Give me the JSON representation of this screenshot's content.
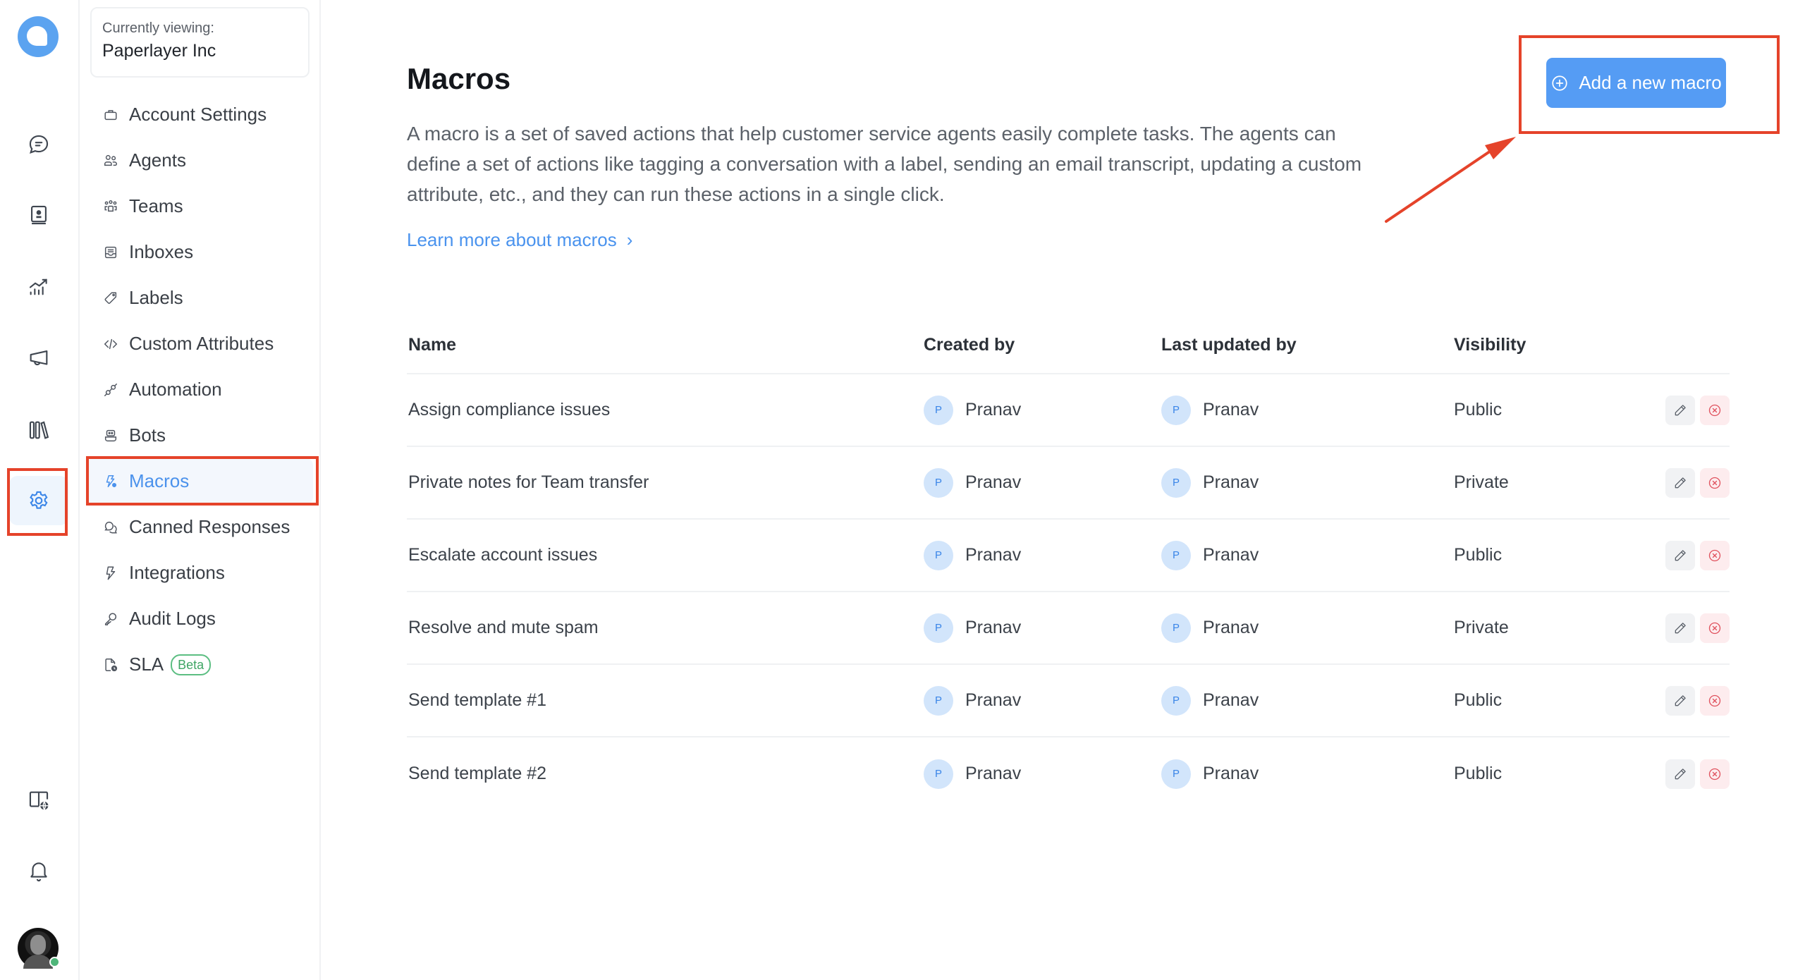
{
  "rail": {
    "items": [
      {
        "icon": "chat-bubble-icon",
        "label": "Conversations"
      },
      {
        "icon": "contact-book-icon",
        "label": "Contacts"
      },
      {
        "icon": "reports-chart-icon",
        "label": "Reports"
      },
      {
        "icon": "megaphone-icon",
        "label": "Campaigns"
      },
      {
        "icon": "library-icon",
        "label": "Help Center"
      },
      {
        "icon": "gear-icon",
        "label": "Settings",
        "active": true
      }
    ],
    "bottom": [
      {
        "icon": "portal-globe-icon",
        "label": "Portal"
      },
      {
        "icon": "bell-icon",
        "label": "Notifications"
      }
    ],
    "user_status": "online"
  },
  "account": {
    "label": "Currently viewing:",
    "name": "Paperlayer Inc"
  },
  "sidebar": {
    "items": [
      {
        "label": "Account Settings",
        "icon": "briefcase-icon"
      },
      {
        "label": "Agents",
        "icon": "people-icon"
      },
      {
        "label": "Teams",
        "icon": "team-icon"
      },
      {
        "label": "Inboxes",
        "icon": "inbox-icon"
      },
      {
        "label": "Labels",
        "icon": "tag-icon"
      },
      {
        "label": "Custom Attributes",
        "icon": "code-icon"
      },
      {
        "label": "Automation",
        "icon": "plug-icon"
      },
      {
        "label": "Bots",
        "icon": "bot-icon"
      },
      {
        "label": "Macros",
        "icon": "flash-settings-icon",
        "active": true
      },
      {
        "label": "Canned Responses",
        "icon": "chat-multiple-icon"
      },
      {
        "label": "Integrations",
        "icon": "lightning-icon"
      },
      {
        "label": "Audit Logs",
        "icon": "key-icon"
      },
      {
        "label": "SLA",
        "icon": "document-clock-icon",
        "badge": "Beta"
      }
    ]
  },
  "main": {
    "title": "Macros",
    "description": "A macro is a set of saved actions that help customer service agents easily complete tasks. The agents can define a set of actions like tagging a conversation with a label, sending an email transcript, updating a custom attribute, etc., and they can run these actions in a single click.",
    "learn_more": "Learn more about macros",
    "add_button": "Add a new macro"
  },
  "table": {
    "columns": [
      "Name",
      "Created by",
      "Last updated by",
      "Visibility"
    ],
    "rows": [
      {
        "name": "Assign compliance issues",
        "created_by": "Pranav",
        "created_initial": "P",
        "updated_by": "Pranav",
        "updated_initial": "P",
        "visibility": "Public"
      },
      {
        "name": "Private notes for Team transfer",
        "created_by": "Pranav",
        "created_initial": "P",
        "updated_by": "Pranav",
        "updated_initial": "P",
        "visibility": "Private"
      },
      {
        "name": "Escalate account issues",
        "created_by": "Pranav",
        "created_initial": "P",
        "updated_by": "Pranav",
        "updated_initial": "P",
        "visibility": "Public"
      },
      {
        "name": "Resolve and mute spam",
        "created_by": "Pranav",
        "created_initial": "P",
        "updated_by": "Pranav",
        "updated_initial": "P",
        "visibility": "Private"
      },
      {
        "name": "Send template #1",
        "created_by": "Pranav",
        "created_initial": "P",
        "updated_by": "Pranav",
        "updated_initial": "P",
        "visibility": "Public"
      },
      {
        "name": "Send template #2",
        "created_by": "Pranav",
        "created_initial": "P",
        "updated_by": "Pranav",
        "updated_initial": "P",
        "visibility": "Public"
      }
    ]
  },
  "colors": {
    "accent": "#559cf4",
    "link": "#4a93ee",
    "danger": "#e0525e",
    "annotation": "#e5432a",
    "beta": "#3fa564"
  }
}
